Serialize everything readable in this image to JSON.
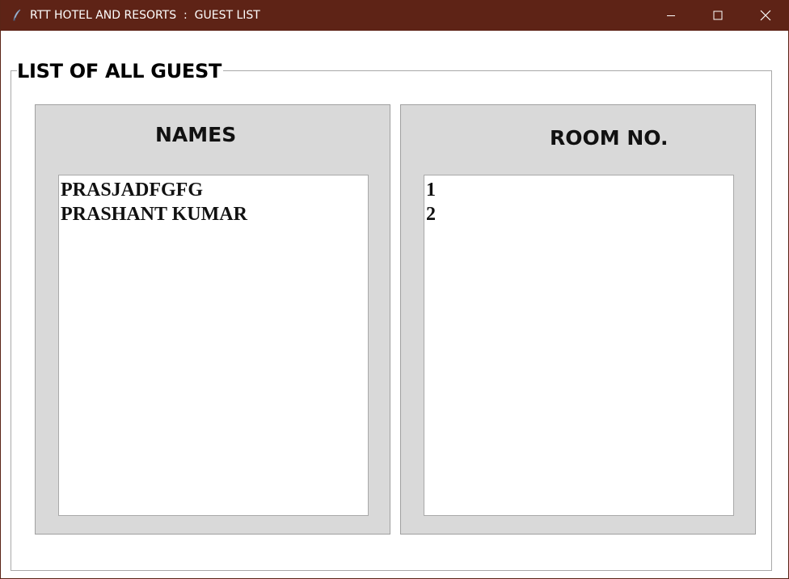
{
  "window": {
    "title": "RTT HOTEL AND RESORTS  :  GUEST LIST",
    "titlebar_color": "#5e2316",
    "app_icon": "feather-icon",
    "controls": [
      "minimize-icon",
      "maximize-icon",
      "close-icon"
    ]
  },
  "group": {
    "label": "LIST OF ALL GUEST"
  },
  "names_panel": {
    "heading": "NAMES",
    "items": [
      "PRASJADFGFG",
      "PRASHANT KUMAR"
    ]
  },
  "rooms_panel": {
    "heading": "ROOM NO.",
    "items": [
      "1",
      "2"
    ]
  },
  "colors": {
    "panel_bg": "#d9d9d9",
    "list_bg": "#ffffff"
  }
}
